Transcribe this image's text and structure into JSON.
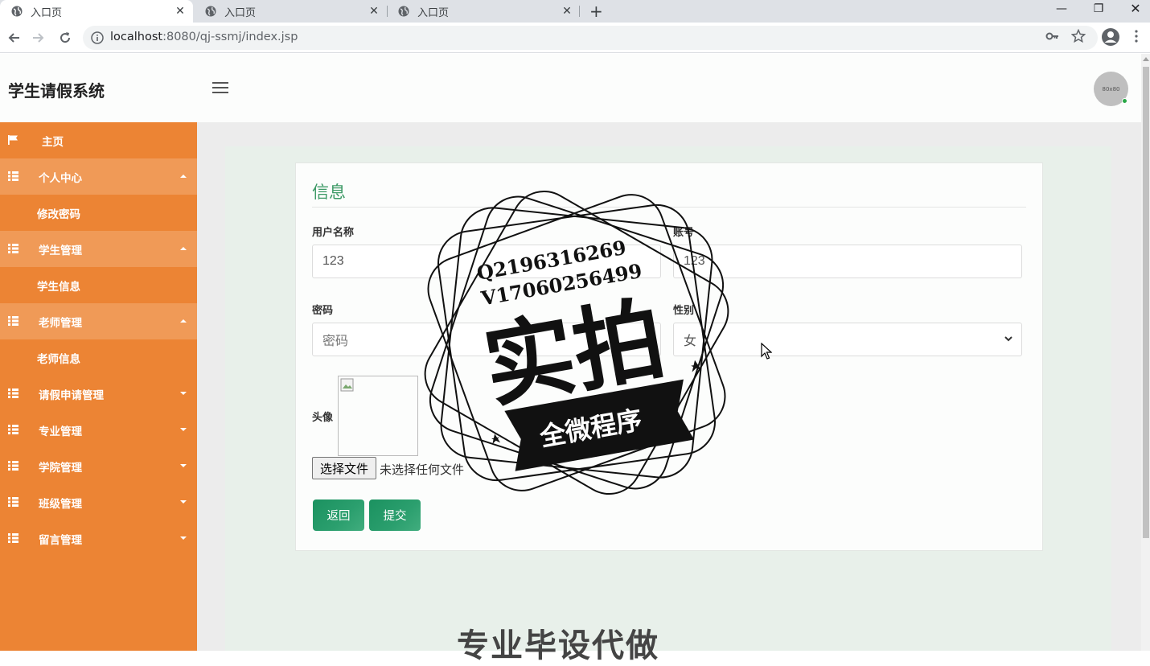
{
  "browser": {
    "tabs": [
      {
        "title": "入口页",
        "active": true
      },
      {
        "title": "入口页",
        "active": false
      },
      {
        "title": "入口页",
        "active": false
      }
    ],
    "address": {
      "host": "localhost",
      "path": ":8080/qj-ssmj/index.jsp"
    }
  },
  "header": {
    "brand": "学生请假系统",
    "avatar_text": "80x80"
  },
  "sidebar": {
    "items": [
      {
        "label": "主页",
        "icon": "flag-icon",
        "type": "item",
        "caret": "none"
      },
      {
        "label": "个人中心",
        "icon": "grid-icon",
        "type": "group",
        "caret": "up"
      },
      {
        "label": "修改密码",
        "type": "sub"
      },
      {
        "label": "学生管理",
        "icon": "grid-icon",
        "type": "group",
        "caret": "up"
      },
      {
        "label": "学生信息",
        "type": "sub"
      },
      {
        "label": "老师管理",
        "icon": "grid-icon",
        "type": "group",
        "caret": "up"
      },
      {
        "label": "老师信息",
        "type": "sub"
      },
      {
        "label": "请假申请管理",
        "icon": "grid-icon",
        "type": "group",
        "caret": "down"
      },
      {
        "label": "专业管理",
        "icon": "grid-icon",
        "type": "group",
        "caret": "down"
      },
      {
        "label": "学院管理",
        "icon": "grid-icon",
        "type": "group",
        "caret": "down"
      },
      {
        "label": "班级管理",
        "icon": "grid-icon",
        "type": "group",
        "caret": "down"
      },
      {
        "label": "留言管理",
        "icon": "grid-icon",
        "type": "group",
        "caret": "down"
      }
    ]
  },
  "form": {
    "title": "信息",
    "username_label": "用户名称",
    "username_value": "123",
    "account_label": "账号",
    "account_value": "123",
    "password_label": "密码",
    "password_placeholder": "密码",
    "gender_label": "性别",
    "gender_value": "女",
    "avatar_label": "头像",
    "file_button": "选择文件",
    "file_status": "未选择任何文件",
    "back_button": "返回",
    "submit_button": "提交"
  },
  "watermark": {
    "line1": "Q2196316269",
    "line2": "V17060256499",
    "big": "实拍",
    "banner": "全微程序",
    "bottom_text": "专业毕设代做"
  },
  "colors": {
    "sidebar": "#ec8434",
    "sidebar_open": "#f09a57",
    "accent_green": "#3d9a66",
    "button_green": "#1b9260"
  }
}
